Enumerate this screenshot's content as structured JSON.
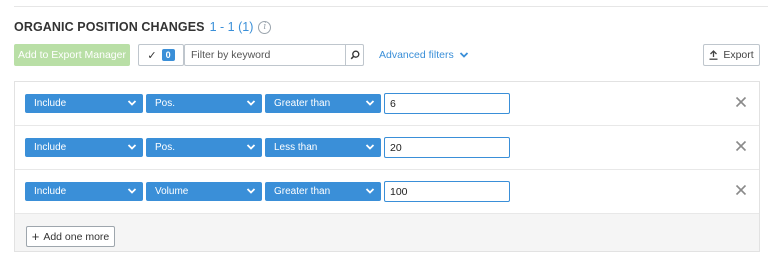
{
  "header": {
    "title": "ORGANIC POSITION CHANGES",
    "count": "1 - 1 (1)",
    "info_icon": "info-icon",
    "info_glyph": "i"
  },
  "toolbar": {
    "export_manager_label": "Add to Export Manager",
    "check_glyph": "✓",
    "selected_count": "0",
    "filter_placeholder": "Filter by keyword",
    "filter_value": "",
    "advanced_filters_label": "Advanced filters",
    "export_label": "Export",
    "export_icon": "upload-icon"
  },
  "filters": {
    "rows": [
      {
        "mode": "Include",
        "field": "Pos.",
        "operator": "Greater than",
        "value": "6"
      },
      {
        "mode": "Include",
        "field": "Pos.",
        "operator": "Less than",
        "value": "20"
      },
      {
        "mode": "Include",
        "field": "Volume",
        "operator": "Greater than",
        "value": "100"
      }
    ],
    "add_more_label": "Add one more"
  },
  "colors": {
    "accent_blue": "#3a8fd8",
    "disabled_green": "#b9dfa6",
    "border_gray": "#bfc6cd",
    "footer_bg": "#f5f5f5"
  }
}
